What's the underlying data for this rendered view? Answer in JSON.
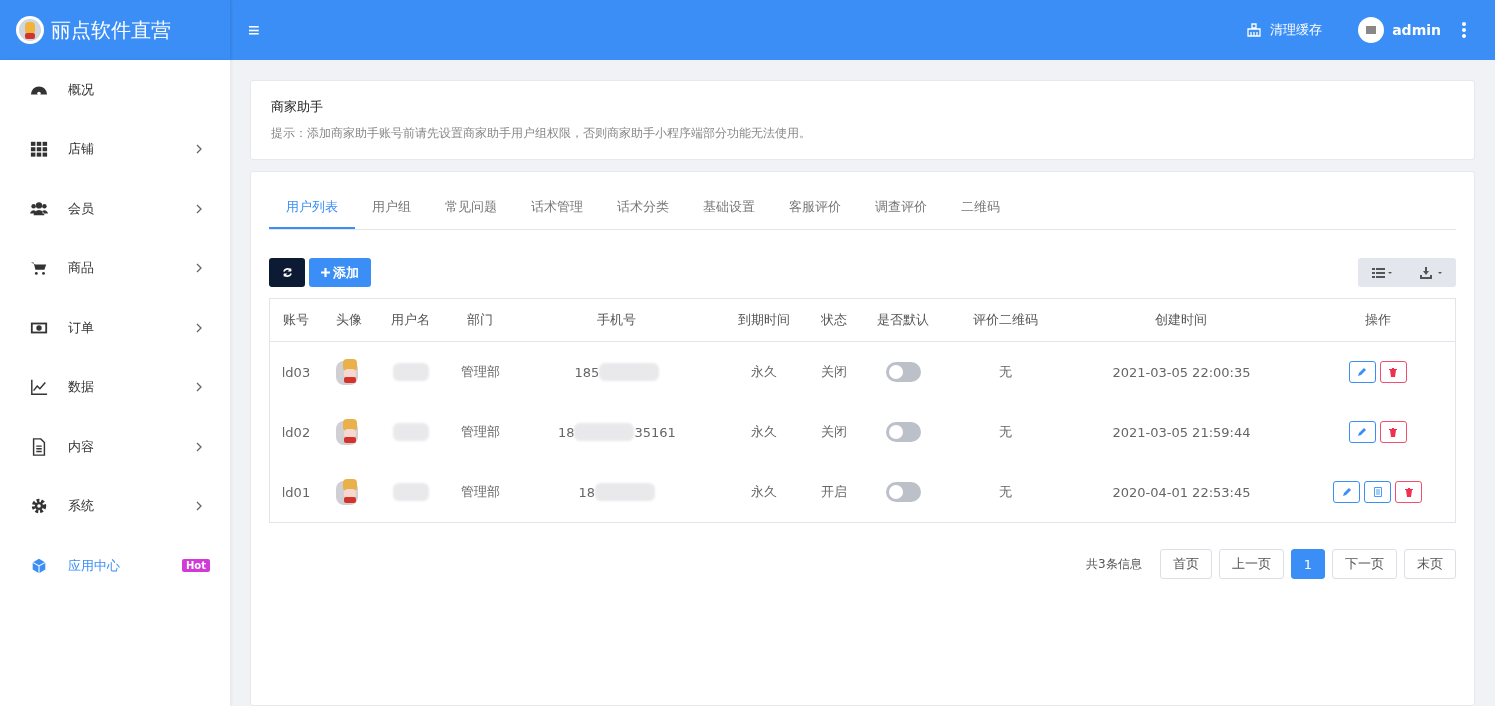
{
  "brand": {
    "title": "丽点软件直营"
  },
  "header": {
    "menu_icon": "≡",
    "clear_cache": "清理缓存",
    "user": "admin"
  },
  "sidebar": {
    "items": [
      {
        "label": "概况",
        "expandable": false,
        "selected": false
      },
      {
        "label": "店铺",
        "expandable": true,
        "selected": false
      },
      {
        "label": "会员",
        "expandable": true,
        "selected": false
      },
      {
        "label": "商品",
        "expandable": true,
        "selected": false
      },
      {
        "label": "订单",
        "expandable": true,
        "selected": false
      },
      {
        "label": "数据",
        "expandable": true,
        "selected": false
      },
      {
        "label": "内容",
        "expandable": true,
        "selected": false
      },
      {
        "label": "系统",
        "expandable": true,
        "selected": false
      },
      {
        "label": "应用中心",
        "expandable": false,
        "selected": true,
        "badge": "Hot"
      }
    ]
  },
  "notice": {
    "title": "商家助手",
    "hint": "提示：添加商家助手账号前请先设置商家助手用户组权限，否则商家助手小程序端部分功能无法使用。"
  },
  "tabs": [
    {
      "label": "用户列表",
      "selected": true
    },
    {
      "label": "用户组",
      "selected": false
    },
    {
      "label": "常见问题",
      "selected": false
    },
    {
      "label": "话术管理",
      "selected": false
    },
    {
      "label": "话术分类",
      "selected": false
    },
    {
      "label": "基础设置",
      "selected": false
    },
    {
      "label": "客服评价",
      "selected": false
    },
    {
      "label": "调查评价",
      "selected": false
    },
    {
      "label": "二维码",
      "selected": false
    }
  ],
  "toolbar": {
    "add": "添加"
  },
  "table": {
    "columns": [
      "账号",
      "头像",
      "用户名",
      "部门",
      "手机号",
      "到期时间",
      "状态",
      "是否默认",
      "评价二维码",
      "创建时间",
      "操作"
    ],
    "rows": [
      {
        "account": "ld03",
        "department": "管理部",
        "phone_start": "185",
        "expiry": "永久",
        "status": "关闭",
        "default_on": false,
        "qrcode": "无",
        "created": "2021-03-05 22:00:35",
        "actions": [
          {
            "kind": "edit"
          },
          {
            "kind": "delete"
          }
        ]
      },
      {
        "account": "ld02",
        "department": "管理部",
        "phone_start": "18",
        "phone_end": "35161",
        "expiry": "永久",
        "status": "关闭",
        "default_on": false,
        "qrcode": "无",
        "created": "2021-03-05 21:59:44",
        "actions": [
          {
            "kind": "edit"
          },
          {
            "kind": "delete"
          }
        ]
      },
      {
        "account": "ld01",
        "department": "管理部",
        "phone_start": "18",
        "expiry": "永久",
        "status": "开启",
        "default_on": false,
        "qrcode": "无",
        "created": "2020-04-01 22:53:45",
        "actions": [
          {
            "kind": "edit"
          },
          {
            "kind": "form"
          },
          {
            "kind": "delete"
          }
        ]
      }
    ]
  },
  "pagination": {
    "total": "共3条信息",
    "first": "首页",
    "prev": "上一页",
    "pages": [
      {
        "label": "1",
        "selected": true
      }
    ],
    "next": "下一页",
    "last": "末页"
  }
}
